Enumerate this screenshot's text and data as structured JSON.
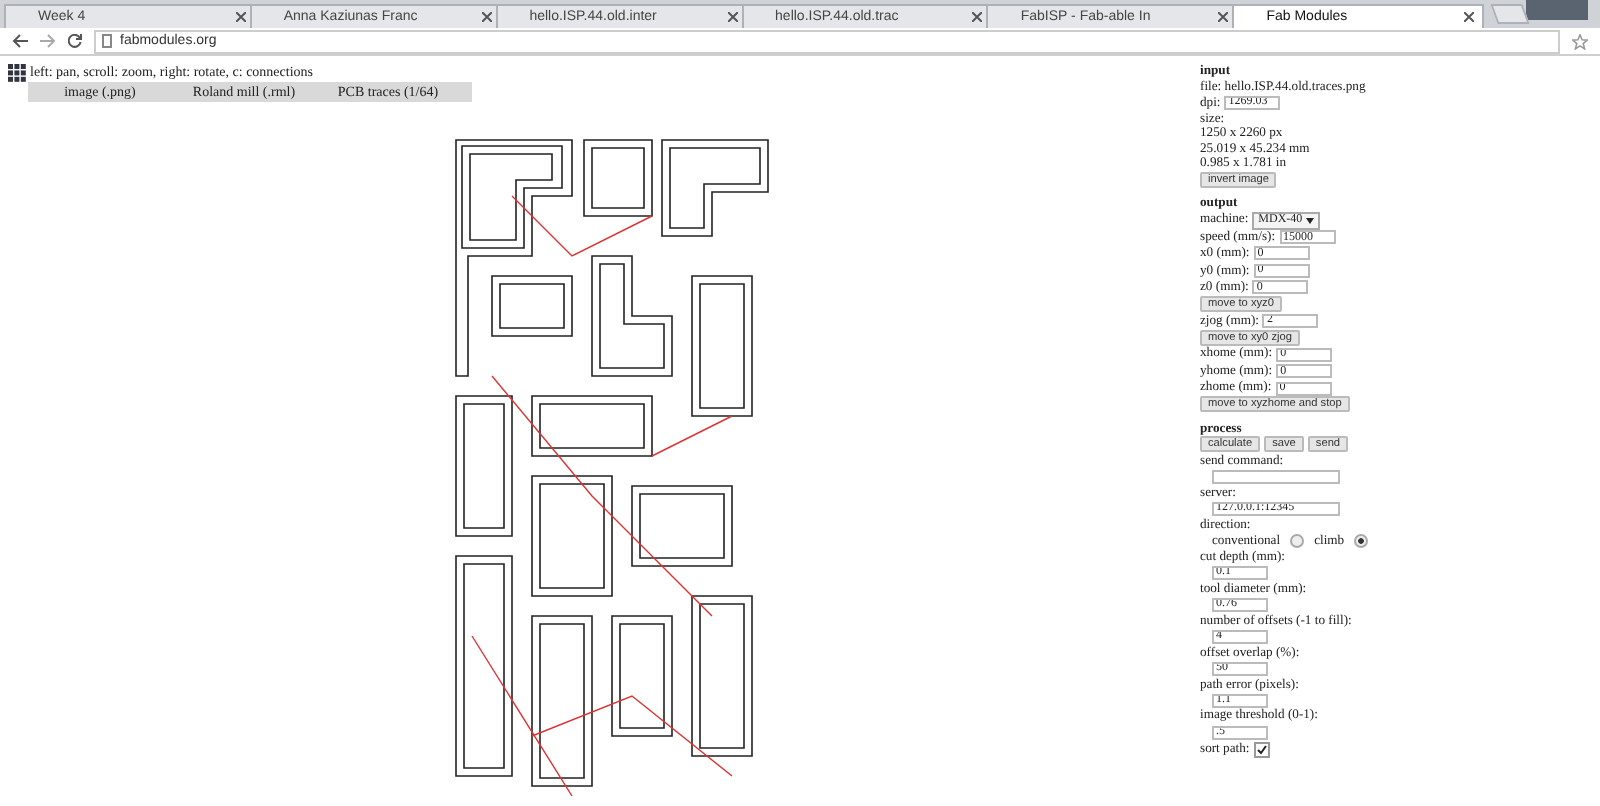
{
  "browser": {
    "tabs": [
      {
        "title": "Week 4",
        "selected": false
      },
      {
        "title": "Anna Kaziunas Franc",
        "selected": false
      },
      {
        "title": "hello.ISP.44.old.inter",
        "selected": false
      },
      {
        "title": "hello.ISP.44.old.trac",
        "selected": false
      },
      {
        "title": "FabISP - Fab-able In",
        "selected": false
      },
      {
        "title": "Fab Modules",
        "selected": true
      }
    ],
    "address": "fabmodules.org"
  },
  "toolbar": {
    "hint": "left: pan, scroll: zoom, right: rotate, c: connections",
    "menus": [
      "image (.png)",
      "Roland mill (.rml)",
      "PCB traces (1/64)"
    ]
  },
  "sections": [
    {
      "heading": "input",
      "rows": [
        {
          "kind": "text",
          "text": "file: hello.ISP.44.old.traces.png"
        },
        {
          "kind": "inline-field",
          "label": "dpi:",
          "value": "1269.03"
        },
        {
          "kind": "text",
          "text": "size:"
        },
        {
          "kind": "text",
          "text": "1250 x 2260 px"
        },
        {
          "kind": "text",
          "text": "25.019 x 45.234 mm"
        },
        {
          "kind": "text",
          "text": "0.985 x 1.781 in"
        },
        {
          "kind": "button",
          "label": "invert image"
        }
      ]
    },
    {
      "heading": "output",
      "rows": [
        {
          "kind": "select",
          "label": "machine:",
          "value": "MDX-40"
        },
        {
          "kind": "inline-field",
          "label": "speed (mm/s):",
          "value": "15000"
        },
        {
          "kind": "inline-field",
          "label": "x0 (mm):",
          "value": "0"
        },
        {
          "kind": "inline-field",
          "label": "y0 (mm):",
          "value": "0"
        },
        {
          "kind": "inline-field",
          "label": "z0 (mm):",
          "value": "0"
        },
        {
          "kind": "button",
          "label": "move to xyz0"
        },
        {
          "kind": "inline-field",
          "label": "zjog (mm):",
          "value": "2"
        },
        {
          "kind": "button",
          "label": "move to xy0 zjog"
        },
        {
          "kind": "inline-field",
          "label": "xhome (mm):",
          "value": "0"
        },
        {
          "kind": "inline-field",
          "label": "yhome (mm):",
          "value": "0"
        },
        {
          "kind": "inline-field",
          "label": "zhome (mm):",
          "value": "0"
        },
        {
          "kind": "button",
          "label": "move to xyzhome and stop"
        }
      ]
    },
    {
      "heading": "process",
      "rows": [
        {
          "kind": "buttons",
          "labels": [
            "calculate",
            "save",
            "send"
          ]
        },
        {
          "kind": "stacked-field",
          "label": "send command:"
        },
        {
          "kind": "stacked-field",
          "label": "server:",
          "value": "127.0.0.1:12345"
        },
        {
          "kind": "radios",
          "label": "direction:",
          "options": [
            {
              "label": "conventional",
              "selected": false
            },
            {
              "label": "climb",
              "selected": true
            }
          ]
        },
        {
          "kind": "stacked-field",
          "label": "cut depth (mm):",
          "value": "0.1"
        },
        {
          "kind": "stacked-field",
          "label": "tool diameter (mm):",
          "value": "0.76"
        },
        {
          "kind": "stacked-field",
          "label": "number of offsets (-1 to fill):",
          "value": "4"
        },
        {
          "kind": "stacked-field",
          "label": "offset overlap (%):",
          "value": "50"
        },
        {
          "kind": "stacked-field",
          "label": "path error (pixels):",
          "value": "1.1"
        },
        {
          "kind": "stacked-field",
          "label": "image threshold (0-1):",
          "value": ".5"
        },
        {
          "kind": "checkbox",
          "label": "sort path:",
          "checked": true
        }
      ]
    }
  ]
}
